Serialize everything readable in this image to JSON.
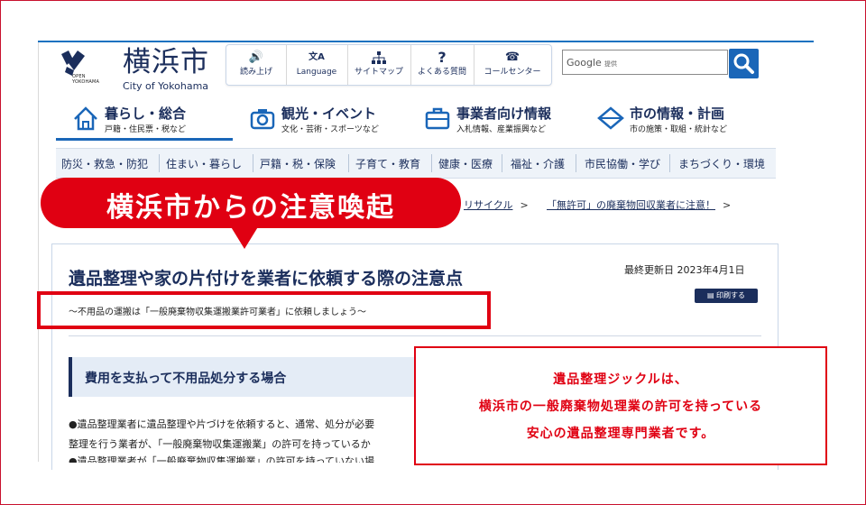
{
  "header": {
    "logo_jp": "横浜市",
    "logo_en": "City of Yokohama",
    "emblem_text": [
      "OPEN",
      "YOKOHAMA"
    ]
  },
  "utility": [
    {
      "label": "読み上げ",
      "icon": "speaker-icon",
      "glyph": "🔊"
    },
    {
      "label": "Language",
      "icon": "translate-icon",
      "glyph": "文A"
    },
    {
      "label": "サイトマップ",
      "icon": "sitemap-icon",
      "glyph": "⊤"
    },
    {
      "label": "よくある質問",
      "icon": "question-icon",
      "glyph": "?"
    },
    {
      "label": "コールセンター",
      "icon": "phone-icon",
      "glyph": "☎"
    }
  ],
  "search": {
    "brand": "Google",
    "suffix": "提供"
  },
  "main_nav": [
    {
      "title": "暮らし・総合",
      "sub": "戸籍・住民票・税など",
      "icon": "house-icon"
    },
    {
      "title": "観光・イベント",
      "sub": "文化・芸術・スポーツなど",
      "icon": "camera-icon"
    },
    {
      "title": "事業者向け情報",
      "sub": "入札情報、産業振興など",
      "icon": "briefcase-icon"
    },
    {
      "title": "市の情報・計画",
      "sub": "市の施策・取組・統計など",
      "icon": "city-hall-icon"
    }
  ],
  "category_nav": [
    "防災・救急・防犯",
    "住まい・暮らし",
    "戸籍・税・保険",
    "子育て・教育",
    "健康・医療",
    "福祉・介護",
    "市民協働・学び",
    "まちづくり・環境"
  ],
  "breadcrumb": {
    "items": [
      "リサイクル",
      "「無許可」の廃棄物回収業者に注意！"
    ],
    "separator": ">"
  },
  "callout": {
    "text": "横浜市からの注意喚起",
    "color": "#e00012"
  },
  "article": {
    "title": "遺品整理や家の片付けを業者に依頼する際の注意点",
    "updated": "最終更新日 2023年4月1日",
    "print_label": "印刷する",
    "subtitle": "～不用品の運搬は「一般廃棄物収集運搬業許可業者」に依頼しましょう～",
    "section_heading": "費用を支払って不用品処分する場合",
    "body_lines": [
      "●遺品整理業者に遺品整理や片づけを依頼すると、通常、処分が必要",
      "整理を行う業者が、「一般廃棄物収集運搬業」の許可を持っているか",
      "●遺品整理業者が「一般廃棄物収集運搬業」の許可を持っていない場"
    ]
  },
  "info_box": {
    "lines": [
      "遺品整理ジックルは、",
      "横浜市の一般廃棄物処理業の許可を持っている",
      "安心の遺品整理専門業者です。"
    ]
  },
  "colors": {
    "navy": "#1b2e5c",
    "accent_blue": "#1a66b8",
    "alert_red": "#e00012"
  }
}
